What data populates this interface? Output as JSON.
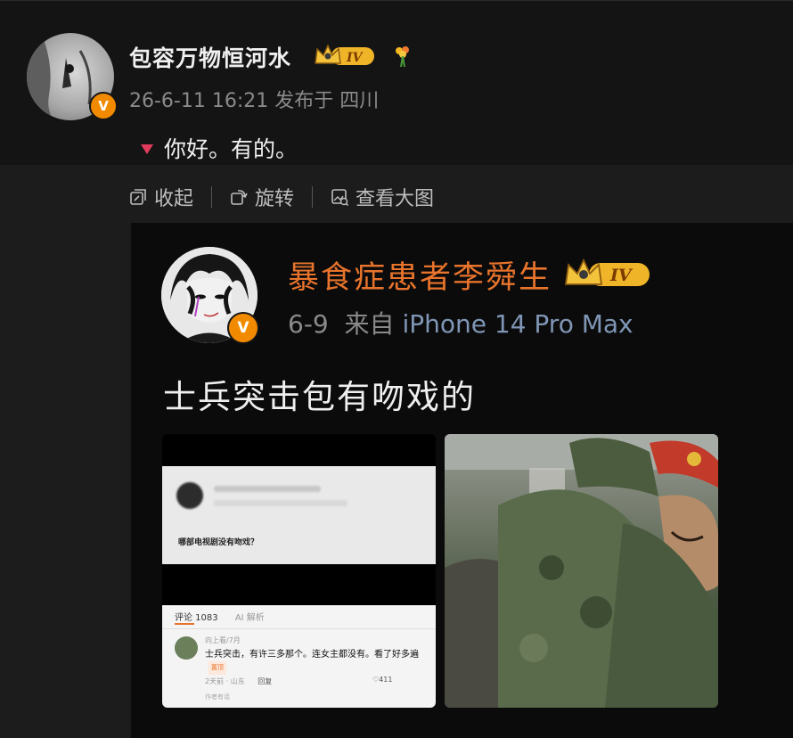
{
  "comment": {
    "username": "包容万物恒河水",
    "level_badge": "IV",
    "timestamp": "26-6-11 16:21",
    "location": "发布于 四川",
    "text": "你好。有的。"
  },
  "toolbar": {
    "collapse_label": "收起",
    "rotate_label": "旋转",
    "view_large_label": "查看大图"
  },
  "embedded_post": {
    "username": "暴食症患者李舜生",
    "level_badge": "IV",
    "date": "6-9",
    "from_label": "来自",
    "device": "iPhone 14 Pro Max",
    "text": "士兵突击包有吻戏的",
    "inner_screenshot": {
      "question": "哪部电视剧没有吻戏？",
      "tab_comments": "评论 1083",
      "tab_ai": "AI 解析",
      "commenter_meta": "向上看/7月",
      "comment_text": "士兵突击，有许三多那个。连女主都没有。看了好多遍",
      "comment_tag": "置顶",
      "comment_time": "2天前 · 山东",
      "reply_label": "回复",
      "likes": "411",
      "footer": "作者有话"
    }
  },
  "colors": {
    "background": "#141414",
    "accent_orange": "#e8742c",
    "verified_badge": "#f28a00",
    "device_blue": "#7f96b6",
    "marker_pink": "#e23a5c"
  },
  "icons": {
    "verified": "verified-v-badge",
    "crown": "crown-level-badge",
    "flower": "bouquet-icon",
    "collapse": "collapse-icon",
    "rotate": "rotate-icon",
    "view_large": "view-large-image-icon"
  }
}
